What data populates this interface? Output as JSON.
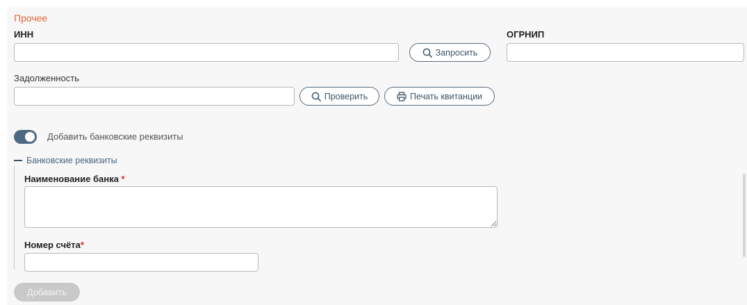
{
  "section": {
    "title": "Прочее"
  },
  "inn": {
    "label": "ИНН",
    "value": "",
    "request_label": "Запросить"
  },
  "ogrnip": {
    "label": "ОГРНИП",
    "value": ""
  },
  "debt": {
    "label": "Задолженность",
    "value": "",
    "check_label": "Проверить",
    "print_label": "Печать квитанции"
  },
  "bank_toggle": {
    "label": "Добавить банковские реквизиты",
    "on": true
  },
  "bank_group": {
    "title": "Банковские реквизиты",
    "bank_name_label": "Наименование банка",
    "account_label": "Номер счёта",
    "required_mark": "*"
  },
  "actions": {
    "add_label": "Добавить"
  },
  "colors": {
    "accent": "#e0663b",
    "primary": "#4e6a83",
    "required": "#d9262b"
  }
}
